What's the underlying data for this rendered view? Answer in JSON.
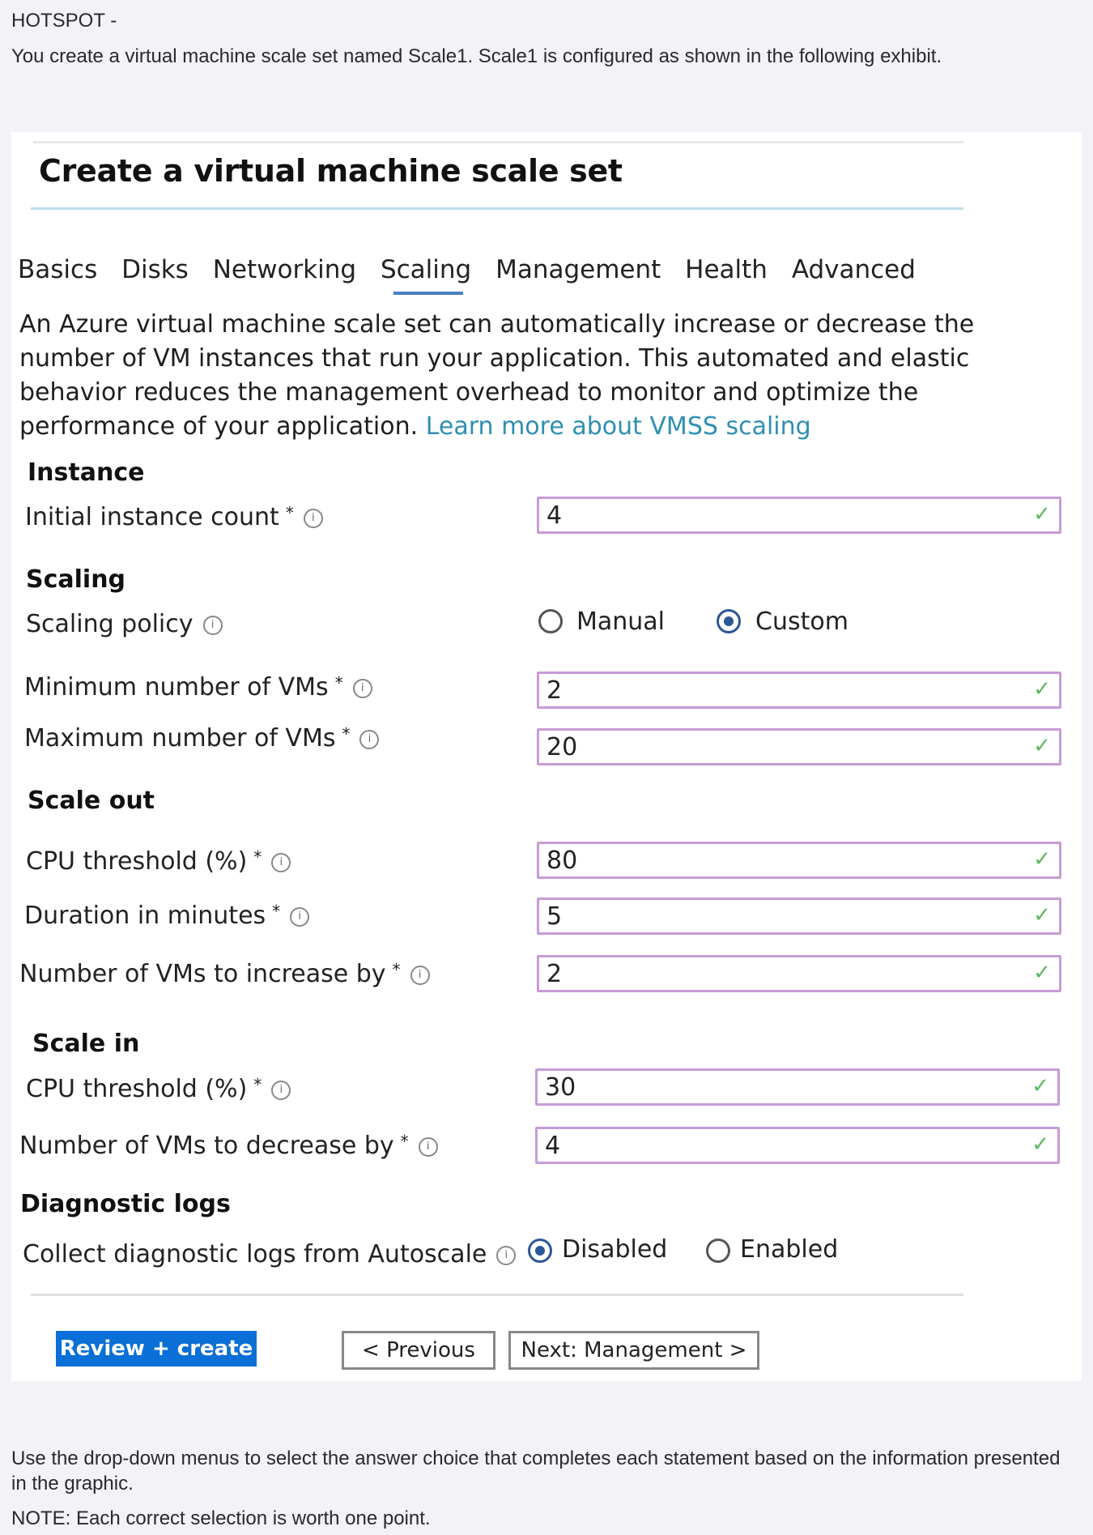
{
  "question": {
    "header": "HOTSPOT -",
    "intro": "You create a virtual machine scale set named Scale1. Scale1 is configured as shown in the following exhibit.",
    "instructions": "Use the drop-down menus to select the answer choice that completes each statement based on the information presented in the graphic.",
    "note": "NOTE: Each correct selection is worth one point."
  },
  "exhibit": {
    "title": "Create a virtual machine scale set",
    "tabs": [
      "Basics",
      "Disks",
      "Networking",
      "Scaling",
      "Management",
      "Health",
      "Advanced"
    ],
    "active_tab": "Scaling",
    "description": "An Azure virtual machine scale set can automatically increase or decrease the number of VM instances that run your application. This automated and elastic behavior reduces the management overhead to monitor and optimize the performance of your application.",
    "learn_more": "Learn more about VMSS scaling",
    "instance": {
      "section": "Instance",
      "initial_count_label": "Initial instance count",
      "initial_count": "4"
    },
    "scaling": {
      "section": "Scaling",
      "policy_label": "Scaling policy",
      "policy_options": [
        "Manual",
        "Custom"
      ],
      "policy_selected": "Custom",
      "min_label": "Minimum number of VMs",
      "min_value": "2",
      "max_label": "Maximum number of VMs",
      "max_value": "20"
    },
    "scale_out": {
      "section": "Scale out",
      "cpu_label": "CPU threshold (%)",
      "cpu_value": "80",
      "duration_label": "Duration in minutes",
      "duration_value": "5",
      "increase_label": "Number of VMs to increase by",
      "increase_value": "2"
    },
    "scale_in": {
      "section": "Scale in",
      "cpu_label": "CPU threshold (%)",
      "cpu_value": "30",
      "decrease_label": "Number of VMs to decrease by",
      "decrease_value": "4"
    },
    "diagnostics": {
      "section": "Diagnostic logs",
      "collect_label": "Collect diagnostic logs from Autoscale",
      "options": [
        "Disabled",
        "Enabled"
      ],
      "selected": "Disabled"
    },
    "buttons": {
      "review": "Review + create",
      "previous": "< Previous",
      "next": "Next: Management >"
    },
    "colors": {
      "accent": "#0a6fd6",
      "link": "#2f8fb3",
      "field_border": "#c79cd6",
      "check": "#5cb85c"
    }
  }
}
